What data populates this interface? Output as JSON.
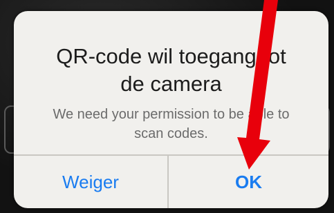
{
  "dialog": {
    "title_line1": "QR-code wil toegang tot",
    "title_line2": "de camera",
    "message_line1": "We need your permission to be able to",
    "message_line2": "scan codes.",
    "cancel_label": "Weiger",
    "ok_label": "OK"
  },
  "colors": {
    "button_text": "#1a7cf0",
    "annotation_arrow": "#e8000b"
  }
}
